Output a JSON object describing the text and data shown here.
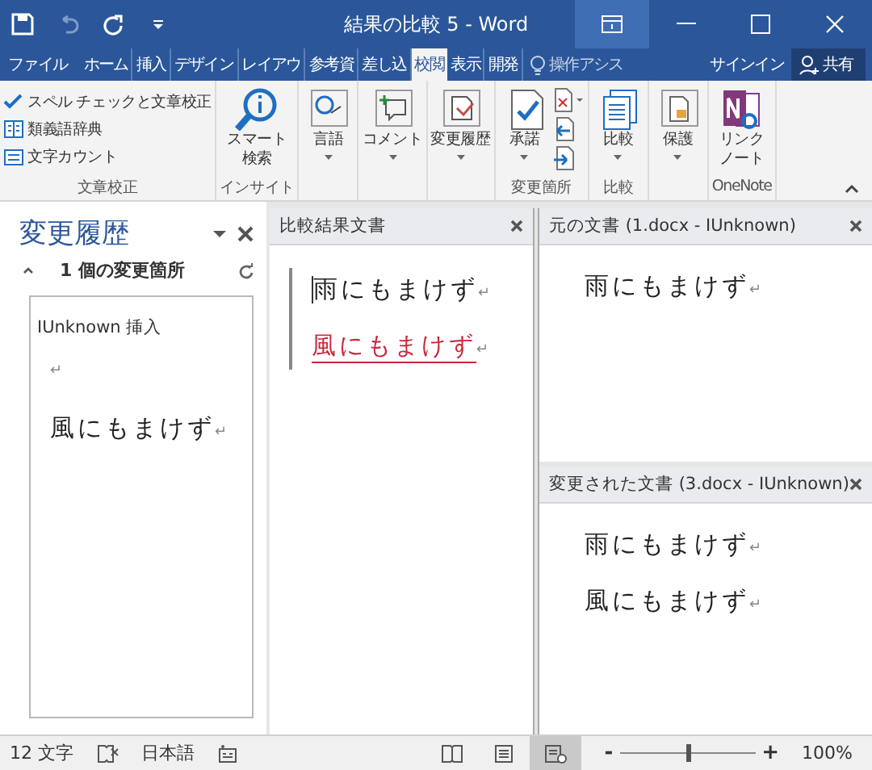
{
  "window": {
    "title": "結果の比較 5 - Word"
  },
  "tabs": [
    {
      "label": "ファイル",
      "selected": false
    },
    {
      "label": "ホーム",
      "selected": false
    },
    {
      "label": "挿入",
      "selected": false
    },
    {
      "label": "デザイン",
      "selected": false
    },
    {
      "label": "レイアウ",
      "selected": false
    },
    {
      "label": "参考資",
      "selected": false
    },
    {
      "label": "差し込",
      "selected": false
    },
    {
      "label": "校閲",
      "selected": true
    },
    {
      "label": "表示",
      "selected": false
    },
    {
      "label": "開発",
      "selected": false
    }
  ],
  "tell_me": {
    "label": "操作アシス"
  },
  "account": {
    "sign_in": "サインイン",
    "share": "共有"
  },
  "ribbon": {
    "groups": [
      {
        "label": "文章校正",
        "items": [
          {
            "kind": "small",
            "label": "スペル チェックと文章校正"
          },
          {
            "kind": "small",
            "label": "類義語辞典"
          },
          {
            "kind": "small",
            "label": "文字カウント"
          }
        ]
      },
      {
        "label": "インサイト",
        "items": [
          {
            "kind": "large",
            "lines": [
              "スマート",
              "検索"
            ],
            "dropdown": false
          }
        ]
      },
      {
        "items": [
          {
            "kind": "large",
            "lines": [
              "言語"
            ],
            "dropdown": true
          }
        ]
      },
      {
        "items": [
          {
            "kind": "large",
            "lines": [
              "コメント"
            ],
            "dropdown": true
          }
        ]
      },
      {
        "items": [
          {
            "kind": "large",
            "lines": [
              "変更履歴"
            ],
            "dropdown": true
          }
        ]
      },
      {
        "label": "変更箇所",
        "items": [
          {
            "kind": "large",
            "lines": [
              "承諾"
            ],
            "dropdown": true
          },
          {
            "kind": "stack"
          }
        ]
      },
      {
        "label": "比較",
        "items": [
          {
            "kind": "large",
            "lines": [
              "比較"
            ],
            "dropdown": true
          }
        ]
      },
      {
        "items": [
          {
            "kind": "large",
            "lines": [
              "保護"
            ],
            "dropdown": true
          }
        ]
      },
      {
        "label": "OneNote",
        "items": [
          {
            "kind": "large",
            "lines": [
              "リンク",
              "ノート"
            ],
            "dropdown": false
          }
        ]
      }
    ]
  },
  "revision_pane": {
    "title": "変更履歴",
    "summary": "1 個の変更箇所",
    "revisions": [
      {
        "heading": "IUnknown 挿入",
        "lines": [
          {
            "mark": "↵"
          },
          {
            "text": "風にもまけず",
            "mark": "↵"
          }
        ]
      }
    ]
  },
  "compare_pane": {
    "title": "比較結果文書",
    "lines": [
      {
        "text": "雨にもまけず",
        "mark": "↵",
        "inserted": false
      },
      {
        "text": "風にもまけず",
        "mark": "↵",
        "inserted": true
      }
    ]
  },
  "original_pane": {
    "title": "元の文書 (1.docx - IUnknown)",
    "lines": [
      {
        "text": "雨にもまけず",
        "mark": "↵"
      }
    ]
  },
  "revised_pane": {
    "title": "変更された文書 (3.docx - IUnknown)",
    "lines": [
      {
        "text": "雨にもまけず",
        "mark": "↵"
      },
      {
        "text": "風にもまけず",
        "mark": "↵"
      }
    ]
  },
  "status_bar": {
    "word_count": "12 文字",
    "language": "日本語",
    "views": [
      {
        "selected": false
      },
      {
        "selected": false
      },
      {
        "selected": true
      }
    ],
    "zoom": {
      "minus": "-",
      "level": 0.5,
      "plus": "+",
      "percent": "100%"
    }
  }
}
